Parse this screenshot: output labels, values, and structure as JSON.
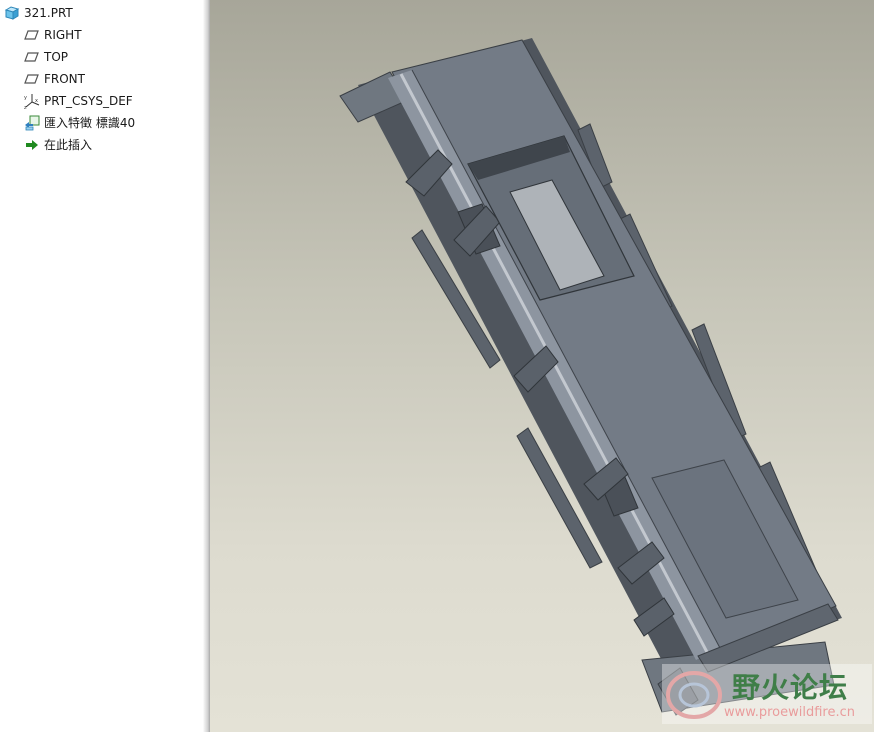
{
  "model_tree": {
    "root": {
      "label": "321.PRT",
      "icon": "part-icon"
    },
    "items": [
      {
        "label": "RIGHT",
        "icon": "datum-plane-icon"
      },
      {
        "label": "TOP",
        "icon": "datum-plane-icon"
      },
      {
        "label": "FRONT",
        "icon": "datum-plane-icon"
      },
      {
        "label": "PRT_CSYS_DEF",
        "icon": "coordinate-system-icon"
      },
      {
        "label": "匯入特徵 標識40",
        "icon": "import-feature-icon"
      },
      {
        "label": "在此插入",
        "icon": "insert-here-arrow-icon"
      }
    ]
  },
  "viewport": {
    "background_top": "#a7a699",
    "background_bottom": "#e4e2d6",
    "model_color": "#737b86"
  },
  "watermark": {
    "title": "野火论坛",
    "url": "www.proewildfire.cn",
    "title_color": "#3f7e48",
    "url_color": "#e99c9c"
  }
}
